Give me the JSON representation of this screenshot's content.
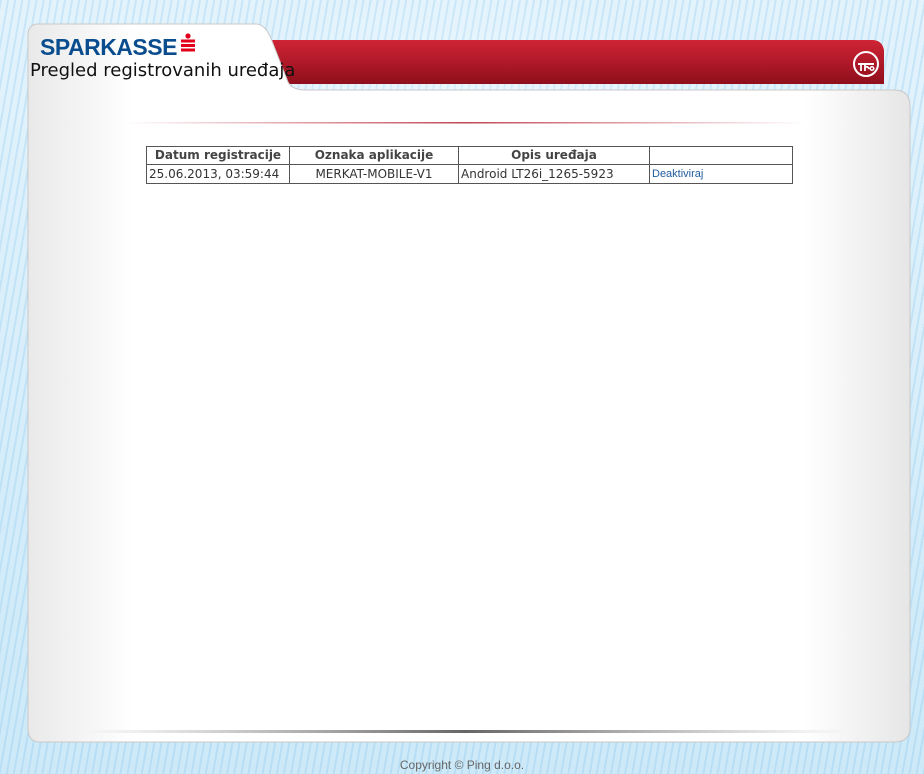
{
  "header": {
    "brand": "SPARKASSE",
    "title": "Pregled registrovanih uređaja"
  },
  "table": {
    "columns": [
      "Datum registracije",
      "Oznaka aplikacije",
      "Opis uređaja",
      ""
    ],
    "rows": [
      {
        "date": "25.06.2013, 03:59:44",
        "app": "MERKAT-MOBILE-V1",
        "description": "Android LT26i_1265-5923",
        "action": "Deaktiviraj"
      }
    ]
  },
  "footer": {
    "copyright": "Copyright © Ping d.o.o."
  },
  "colors": {
    "accent_red": "#b3182a",
    "brand_blue": "#0a4d8f",
    "link_blue": "#1f5b9e"
  },
  "icons": {
    "brand_mark": "sparkasse-s-icon",
    "app_logo": "ping-logo-icon"
  }
}
